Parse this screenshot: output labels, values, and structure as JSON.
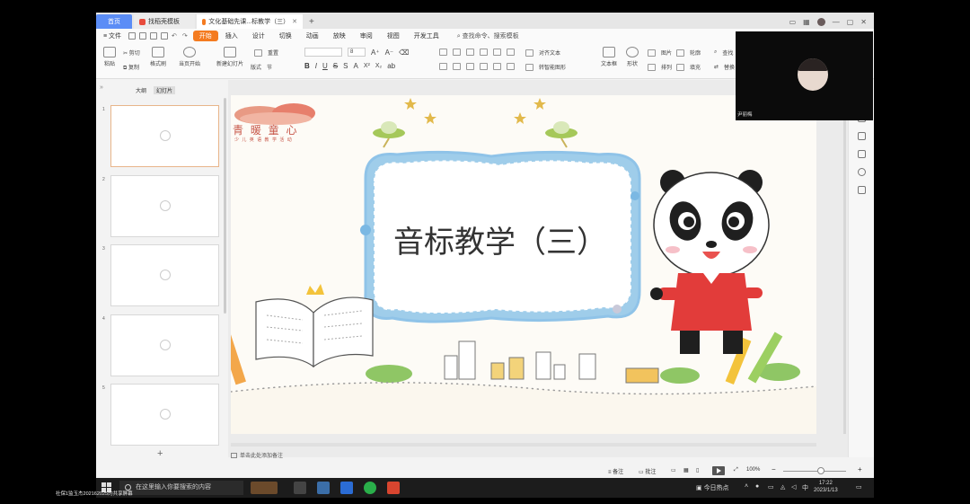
{
  "tabs": {
    "home": "首页",
    "template": "找稻壳模板",
    "document": "文化基础先课...标教学（三）",
    "add": "+"
  },
  "menu": {
    "file": "文件",
    "items": [
      "开始",
      "插入",
      "设计",
      "切换",
      "动画",
      "放映",
      "审阅",
      "视图",
      "开发工具"
    ],
    "active": "开始",
    "search": "查找命令、搜索模板"
  },
  "toolbar": {
    "paste": "粘贴",
    "cut": "剪切",
    "copy": "复制",
    "format_painter": "格式刷",
    "play_from_current": "当页开始",
    "new_slide": "新建幻灯片",
    "layout": "版式",
    "section": "节",
    "reset": "重置",
    "font_size": "8",
    "text_box": "文本框",
    "shape": "形状",
    "arrange": "排列",
    "picture": "图片",
    "fill": "填充",
    "outline": "轮廓",
    "align_text": "对齐文本",
    "convert_smartart": "转智能图形",
    "find": "查找",
    "replace": "替换"
  },
  "left_panel": {
    "tab_outline": "大纲",
    "tab_slides": "幻灯片",
    "slide_numbers": [
      "1",
      "2",
      "3",
      "4",
      "5"
    ],
    "add": "+"
  },
  "slide": {
    "title": "音标教学（三）",
    "logo_text": "青 暖 童 心",
    "logo_sub": "少 儿 英 语 教 学 活 动"
  },
  "notes": {
    "placeholder": "单击此处添加备注"
  },
  "status": {
    "notes": "备注",
    "comments": "批注",
    "zoom": "100%",
    "minus": "−",
    "plus": "+"
  },
  "taskbar": {
    "search_placeholder": "在这里输入你要搜索的内容",
    "news": "今日热点",
    "ime": "中",
    "time": "17:22",
    "date": "2023/1/13"
  },
  "webcam": {
    "name": "尹丽梅"
  },
  "watermark": "社保1监玉杰202162025的共享屏幕",
  "colors": {
    "accent": "#f47b20",
    "home_tab": "#5b8df6",
    "frame_blue": "#8fc3e8"
  }
}
